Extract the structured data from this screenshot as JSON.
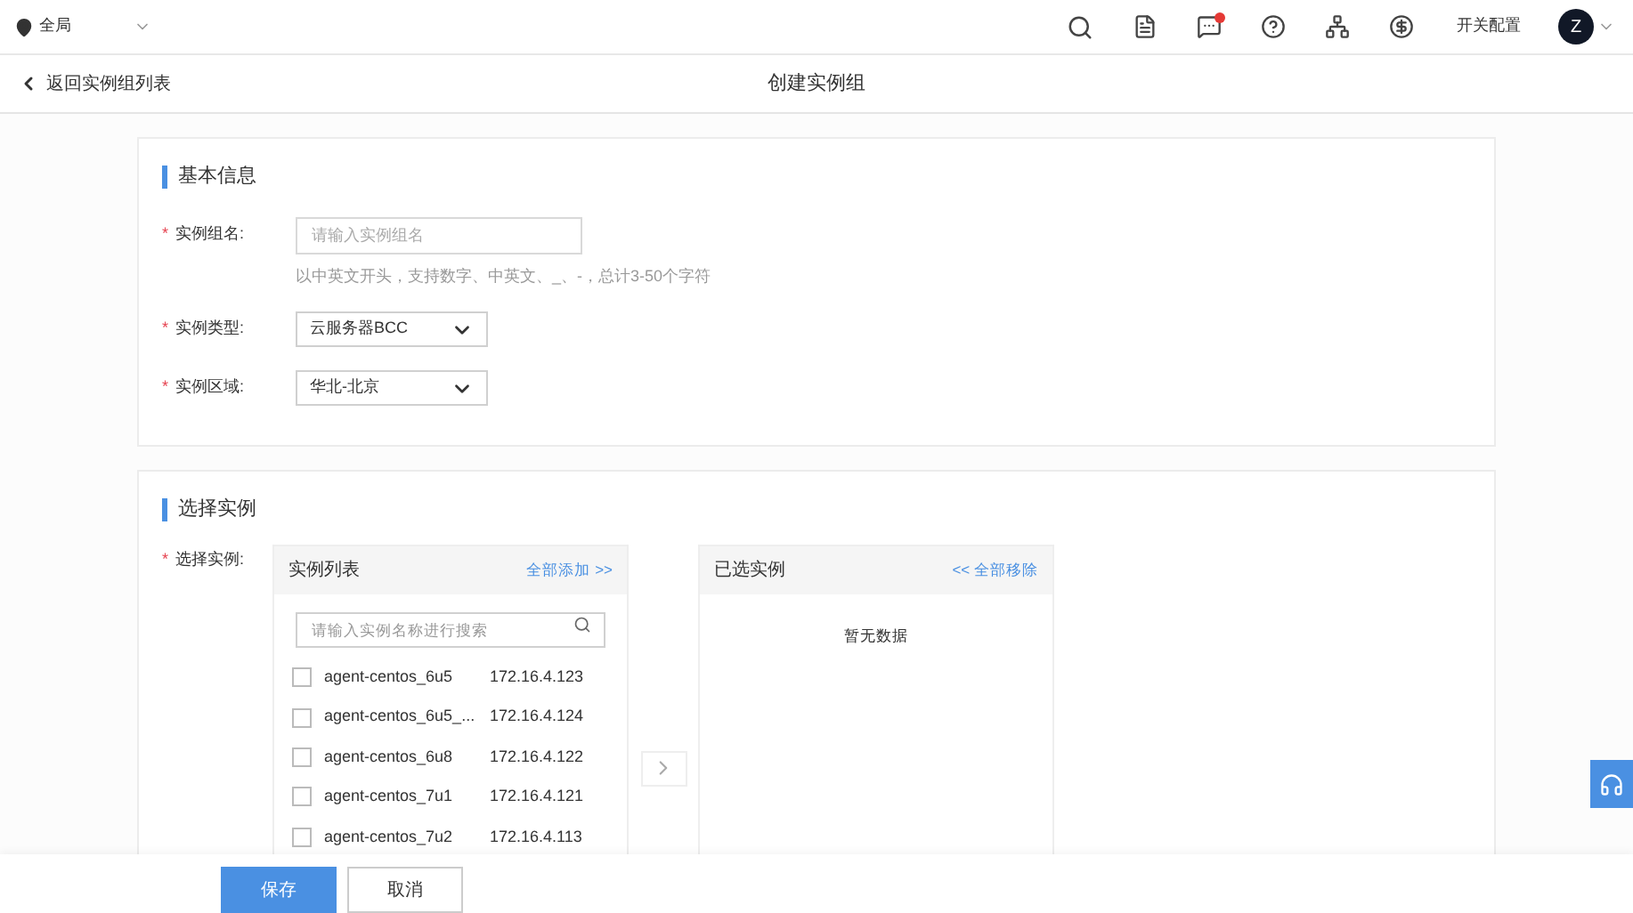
{
  "top_bar": {
    "region": "全局",
    "config_link": "开关配置",
    "avatar": "Z",
    "notification_badge": true
  },
  "sub_header": {
    "back_link": "返回实例组列表",
    "title": "创建实例组"
  },
  "basic_info": {
    "title": "基本信息",
    "fields": [
      {
        "kind": "input",
        "label": "实例组名:",
        "required_mark": "*",
        "placeholder": "请输入实例组名",
        "hint": "以中英文开头，支持数字、中英文、_、-，总计3-50个字符"
      },
      {
        "kind": "select",
        "label": "实例类型:",
        "required_mark": "*",
        "value": "云服务器BCC"
      },
      {
        "kind": "select",
        "label": "实例区域:",
        "required_mark": "*",
        "value": "华北-北京"
      }
    ]
  },
  "select_instances": {
    "title": "选择实例",
    "label": "选择实例:",
    "required_mark": "*",
    "source": {
      "title": "实例列表",
      "action": "全部添加 >>",
      "search_placeholder": "请输入实例名称进行搜索",
      "rows": [
        {
          "name": "agent-centos_6u5",
          "ip": "172.16.4.123",
          "checked": false
        },
        {
          "name": "agent-centos_6u5_...",
          "ip": "172.16.4.124",
          "checked": false
        },
        {
          "name": "agent-centos_6u8",
          "ip": "172.16.4.122",
          "checked": false
        },
        {
          "name": "agent-centos_7u1",
          "ip": "172.16.4.121",
          "checked": false
        },
        {
          "name": "agent-centos_7u2",
          "ip": "172.16.4.113",
          "checked": false
        }
      ]
    },
    "target": {
      "title": "已选实例",
      "action": "<< 全部移除",
      "empty_text": "暂无数据"
    }
  },
  "footer": {
    "buttons": [
      {
        "kind": "primary",
        "label": "保存"
      },
      {
        "kind": "default",
        "label": "取消"
      }
    ]
  }
}
